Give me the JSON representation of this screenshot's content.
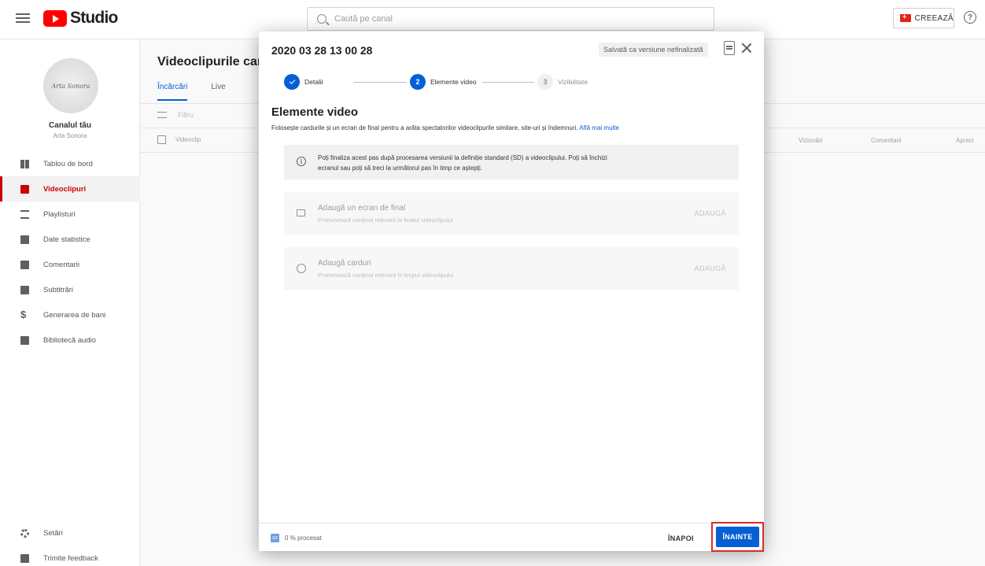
{
  "topbar": {
    "logo_text": "Studio",
    "search_placeholder": "Caută pe canal",
    "create_label": "CREEAZĂ",
    "help_glyph": "?"
  },
  "sidebar": {
    "channel_title": "Canalul tău",
    "channel_name": "Arta Sonora",
    "items": [
      {
        "label": "Tablou de bord",
        "icon": "dashboard-icon"
      },
      {
        "label": "Videoclipuri",
        "icon": "video-icon",
        "active": true
      },
      {
        "label": "Playlisturi",
        "icon": "playlist-icon"
      },
      {
        "label": "Date statistice",
        "icon": "analytics-icon"
      },
      {
        "label": "Comentarii",
        "icon": "comment-icon"
      },
      {
        "label": "Subtitrări",
        "icon": "subtitles-icon"
      },
      {
        "label": "Generarea de bani",
        "icon": "dollar-icon"
      },
      {
        "label": "Bibliotecă audio",
        "icon": "audio-library-icon"
      }
    ],
    "bottom_items": [
      {
        "label": "Setări",
        "icon": "gear-icon"
      },
      {
        "label": "Trimite feedback",
        "icon": "feedback-icon"
      }
    ]
  },
  "main": {
    "page_title": "Videoclipurile cana",
    "tabs": [
      "Încărcări",
      "Live"
    ],
    "filter_label": "Filtru",
    "col_video": "Videoclip",
    "col_views": "Vizionări",
    "col_comments": "Comentarii",
    "col_likes": "Apreci"
  },
  "modal": {
    "title": "2020 03 28 13 00 28",
    "saved_badge": "Salvată ca versiune nefinalizată",
    "steps": [
      {
        "label": "Detalii",
        "number": "",
        "state": "done"
      },
      {
        "label": "Elemente video",
        "number": "2",
        "state": "current"
      },
      {
        "label": "Vizibilitate",
        "number": "3",
        "state": "pending"
      }
    ],
    "section_title": "Elemente video",
    "section_desc": "Folosește cardurile și un ecran de final pentru a arăta spectatorilor videoclipurile similare, site-uri și îndemnuri.",
    "learn_more": "Află mai multe",
    "info_line1": "Poți finaliza acest pas după procesarea versiunii la definiție standard (SD) a videoclipului. Poți să închizi",
    "info_line2": "ecranul sau poți să treci la următorul pas în timp ce aștepți.",
    "end_screen": {
      "title": "Adaugă un ecran de final",
      "subtitle": "Promovează conținut relevant la finalul videoclipului",
      "action": "ADAUGĂ"
    },
    "cards": {
      "title": "Adaugă carduri",
      "subtitle": "Promovează conținut relevant în timpul videoclipului",
      "action": "ADAUGĂ"
    },
    "footer": {
      "sd_badge": "SD",
      "processed": "0 % procesat",
      "back": "ÎNAPOI",
      "next": "ÎNAINTE"
    }
  },
  "colors": {
    "accent_blue": "#065fd4",
    "brand_red": "#ff0000",
    "highlight_red": "#d92c2c"
  }
}
